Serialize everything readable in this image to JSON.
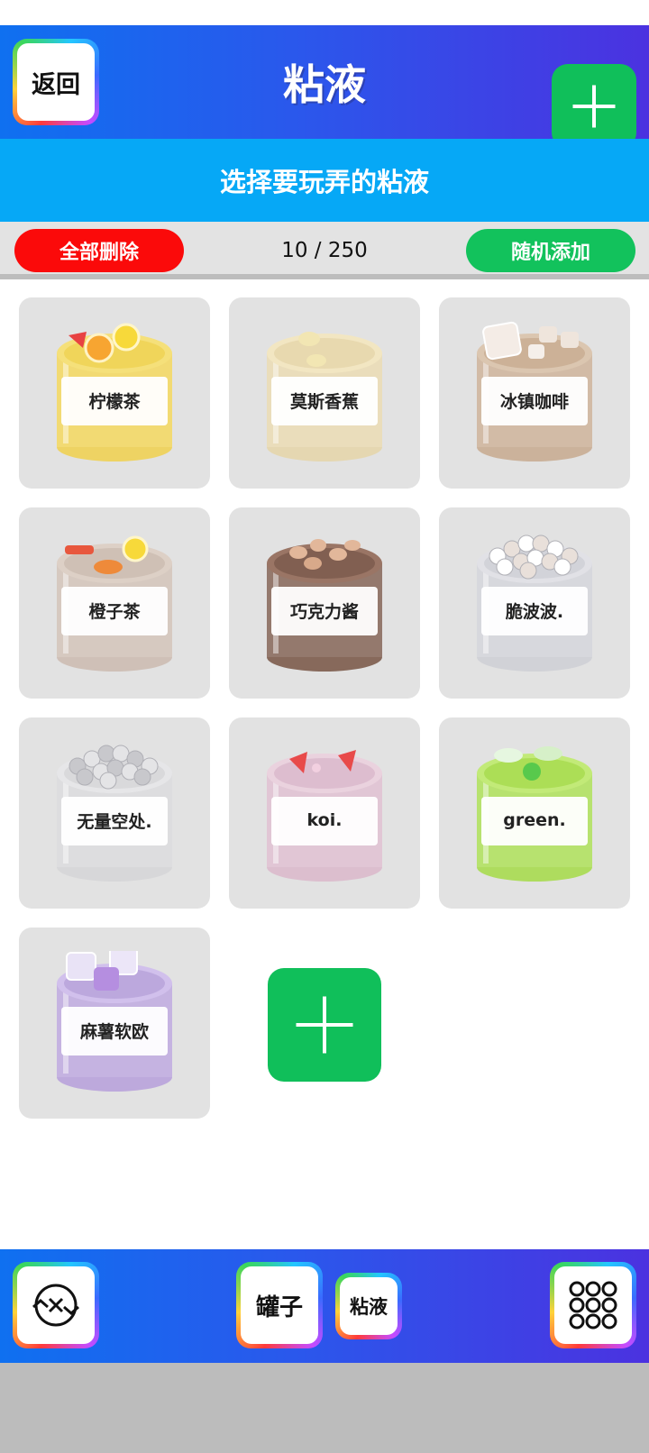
{
  "header": {
    "back_label": "返回",
    "title": "粘液",
    "add_icon": "plus-icon"
  },
  "subtitle": "选择要玩弄的粘液",
  "actions": {
    "delete_all_label": "全部删除",
    "count": "10 / 250",
    "random_add_label": "随机添加"
  },
  "slimes": [
    {
      "name": "柠檬茶",
      "base": "#efd255",
      "rim": "#f5e07a",
      "topping": "citrus-slices"
    },
    {
      "name": "莫斯香蕉",
      "base": "#e6d6ac",
      "rim": "#f2e6c2",
      "topping": "banana-slices"
    },
    {
      "name": "冰镇咖啡",
      "base": "#c9ad93",
      "rim": "#dbc6b0",
      "topping": "ice-cubes"
    },
    {
      "name": "橙子茶",
      "base": "#cdbdb2",
      "rim": "#ddd0c6",
      "topping": "orange-slices"
    },
    {
      "name": "巧克力酱",
      "base": "#7d5c4d",
      "rim": "#9a7565",
      "topping": "nuts"
    },
    {
      "name": "脆波波.",
      "base": "#cfd0d6",
      "rim": "#e1e1e6",
      "topping": "clear-beads"
    },
    {
      "name": "无量空处.",
      "base": "#d6d6d8",
      "rim": "#e6e6e8",
      "topping": "white-pearls"
    },
    {
      "name": "koi.",
      "base": "#dbbacc",
      "rim": "#ead2de",
      "topping": "strawberries"
    },
    {
      "name": "green.",
      "base": "#a8dc50",
      "rim": "#c2ea78",
      "topping": "green-gems"
    },
    {
      "name": "麻薯软欧",
      "base": "#b9a3db",
      "rim": "#d1c0ec",
      "topping": "purple-cubes"
    }
  ],
  "add_tile_icon": "plus-icon",
  "footer": {
    "reset_icon": "reset-arrows-icon",
    "jars_label": "罐子",
    "slime_label": "粘液",
    "grid_icon": "grid-dots-icon"
  }
}
